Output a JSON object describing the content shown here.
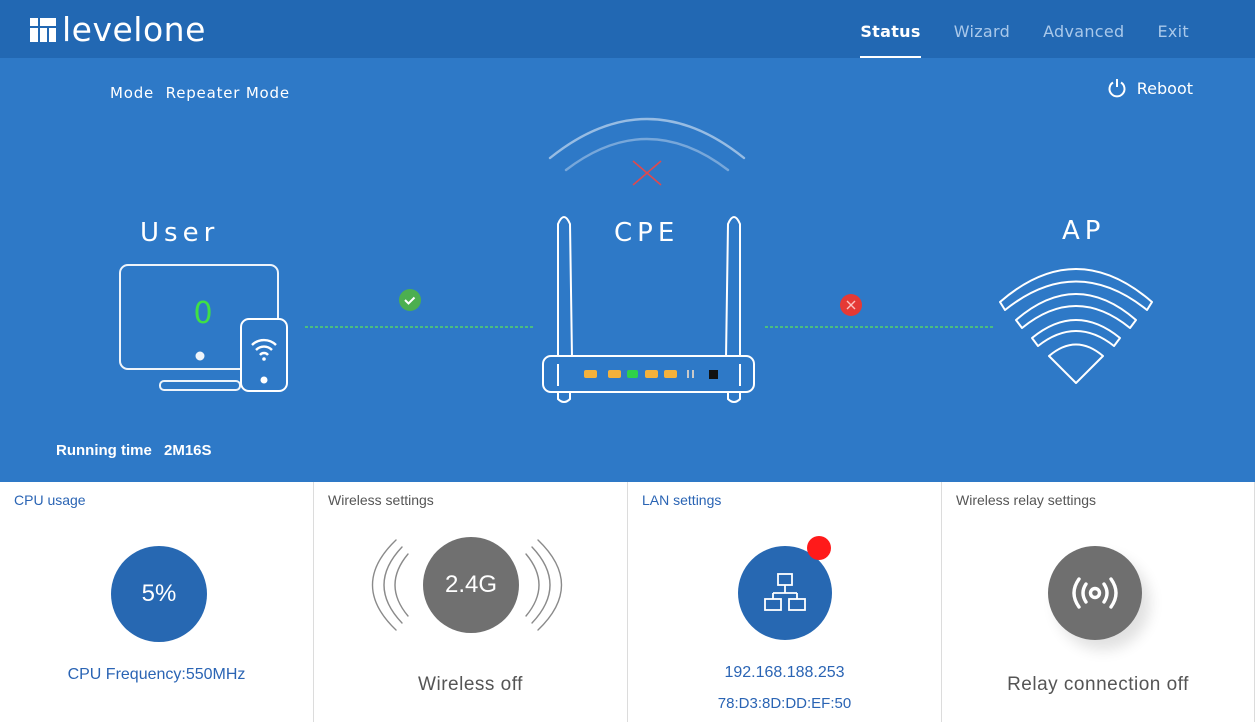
{
  "brand": {
    "name": "levelone"
  },
  "nav": {
    "items": [
      {
        "label": "Status",
        "active": true
      },
      {
        "label": "Wizard",
        "active": false
      },
      {
        "label": "Advanced",
        "active": false
      },
      {
        "label": "Exit",
        "active": false
      }
    ]
  },
  "hero": {
    "mode_label": "Mode",
    "mode_value": "Repeater Mode",
    "reboot_label": "Reboot",
    "user_label": "User",
    "user_count": "0",
    "cpe_label": "CPE",
    "ap_label": "AP",
    "running_label": "Running time",
    "running_value": "2M16S",
    "user_link_status": "ok",
    "ap_link_status": "error",
    "colors": {
      "background": "#2e79c7",
      "ok": "#4caf50",
      "error": "#e53935",
      "count": "#3fe045"
    }
  },
  "panels": {
    "cpu": {
      "title": "CPU usage",
      "value": "5%",
      "footer": "CPU Frequency:550MHz"
    },
    "wireless": {
      "title": "Wireless settings",
      "badge": "2.4G",
      "footer": "Wireless off"
    },
    "lan": {
      "title": "LAN settings",
      "ip": "192.168.188.253",
      "mac": "78:D3:8D:DD:EF:50"
    },
    "relay": {
      "title": "Wireless relay settings",
      "footer": "Relay connection off"
    }
  }
}
